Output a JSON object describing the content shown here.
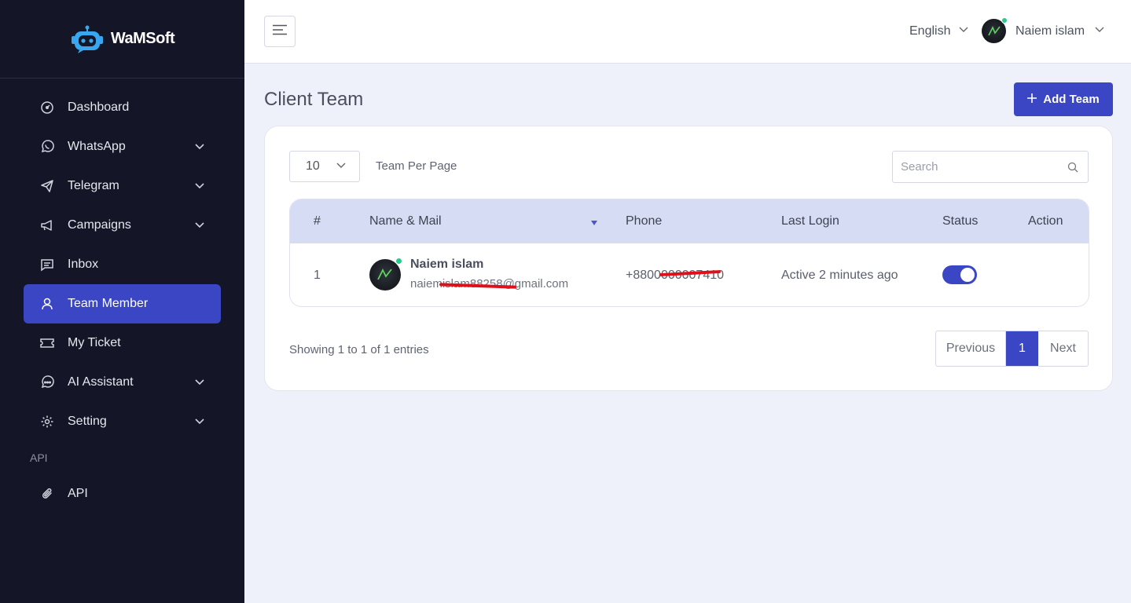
{
  "brand": {
    "name": "WaMSoft"
  },
  "sidebar": {
    "items": [
      {
        "label": "Dashboard",
        "icon": "gauge-icon",
        "has_submenu": false
      },
      {
        "label": "WhatsApp",
        "icon": "whatsapp-icon",
        "has_submenu": true
      },
      {
        "label": "Telegram",
        "icon": "telegram-icon",
        "has_submenu": true
      },
      {
        "label": "Campaigns",
        "icon": "megaphone-icon",
        "has_submenu": true
      },
      {
        "label": "Inbox",
        "icon": "chat-icon",
        "has_submenu": false
      },
      {
        "label": "Team Member",
        "icon": "user-icon",
        "has_submenu": false,
        "active": true
      },
      {
        "label": "My Ticket",
        "icon": "ticket-icon",
        "has_submenu": false
      },
      {
        "label": "AI Assistant",
        "icon": "ai-chat-icon",
        "has_submenu": true
      },
      {
        "label": "Setting",
        "icon": "gear-icon",
        "has_submenu": true
      }
    ],
    "section_label": "API",
    "section_items": [
      {
        "label": "API",
        "icon": "paperclip-icon"
      }
    ]
  },
  "topbar": {
    "language": "English",
    "user_name": "Naiem islam"
  },
  "page": {
    "title": "Client Team",
    "add_button_label": "Add Team"
  },
  "table_controls": {
    "per_page_value": "10",
    "per_page_label": "Team Per Page",
    "search_placeholder": "Search"
  },
  "table": {
    "headers": [
      "#",
      "Name & Mail",
      "Phone",
      "Last Login",
      "Status",
      "Action"
    ],
    "rows": [
      {
        "index": "1",
        "name": "Naiem islam",
        "email": "naiemislam88258@gmail.com",
        "phone": "+8800000007410",
        "last_login": "Active 2 minutes ago",
        "status_on": true
      }
    ]
  },
  "footer": {
    "showing": "Showing 1 to 1 of 1 entries",
    "prev_label": "Previous",
    "current_page": "1",
    "next_label": "Next"
  },
  "colors": {
    "sidebar_bg": "#141627",
    "accent": "#3a46c3",
    "page_bg": "#eef1fa",
    "table_header_bg": "#d7dcf5",
    "online_dot": "#29c98b"
  }
}
